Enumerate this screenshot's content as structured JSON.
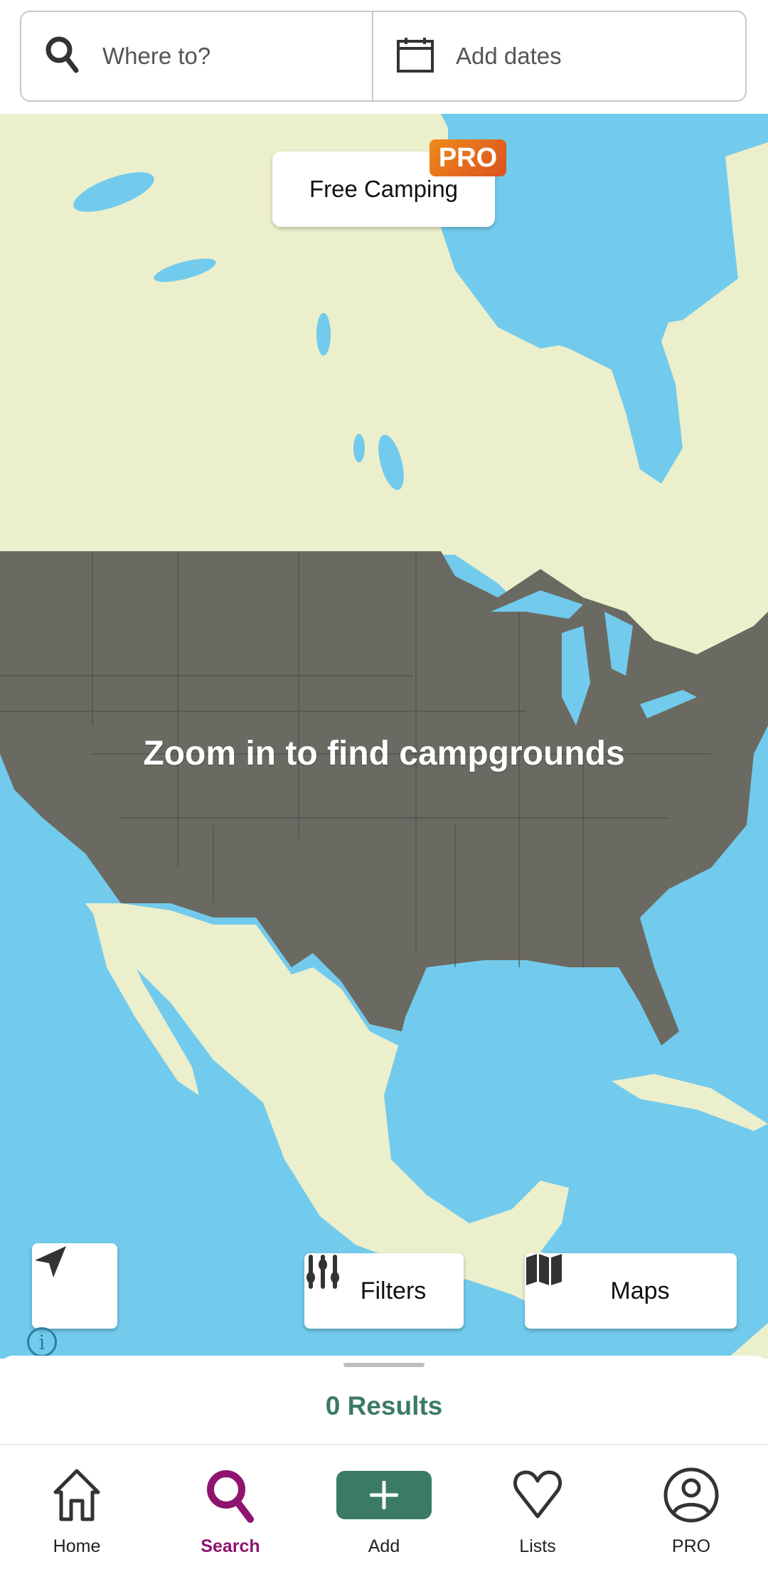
{
  "search": {
    "where_placeholder": "Where to?",
    "dates_placeholder": "Add dates",
    "search_icon": "search-icon",
    "calendar_icon": "calendar-icon"
  },
  "map": {
    "free_camping_label": "Free Camping",
    "pro_badge": "PRO",
    "zoom_message": "Zoom in to find campgrounds",
    "info_glyph": "i",
    "colors": {
      "water": "#72cbec",
      "land": "#ecefcc",
      "usa_overlay": "#6b6a62"
    }
  },
  "controls": {
    "locate_icon": "navigation-arrow-icon",
    "filters_label": "Filters",
    "filters_icon": "sliders-icon",
    "maps_label": "Maps",
    "maps_icon": "folded-map-icon"
  },
  "sheet": {
    "results_label": "0 Results"
  },
  "nav": {
    "active": "Search",
    "accent_color": "#8e1470",
    "add_color": "#3b7a67",
    "items": [
      {
        "label": "Home",
        "icon": "home-icon"
      },
      {
        "label": "Search",
        "icon": "search-icon"
      },
      {
        "label": "Add",
        "icon": "plus-icon"
      },
      {
        "label": "Lists",
        "icon": "heart-icon"
      },
      {
        "label": "PRO",
        "icon": "user-circle-icon"
      }
    ]
  }
}
